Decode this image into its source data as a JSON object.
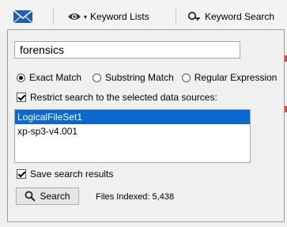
{
  "toolbar": {
    "keyword_lists_label": "Keyword Lists",
    "keyword_search_label": "Keyword Search",
    "dropdown_arrow": "▾"
  },
  "search": {
    "query_value": "forensics"
  },
  "match_options": [
    {
      "label": "Exact Match",
      "checked": true
    },
    {
      "label": "Substring Match",
      "checked": false
    },
    {
      "label": "Regular Expression",
      "checked": false
    }
  ],
  "restrict_label": "Restrict search to the selected data sources:",
  "data_sources": [
    {
      "label": "LogicalFileSet1",
      "selected": true
    },
    {
      "label": "xp-sp3-v4.001",
      "selected": false
    }
  ],
  "save_results_label": "Save search results",
  "search_button_label": "Search",
  "files_indexed_text": "Files Indexed: 5,438",
  "colors": {
    "accent_blue": "#1f5fb4",
    "selection": "#0a68d0",
    "edge_mark": "#d24a4a"
  },
  "icons": [
    "envelope-icon",
    "eye-icon",
    "magnifier-key-icon",
    "search-icon"
  ]
}
